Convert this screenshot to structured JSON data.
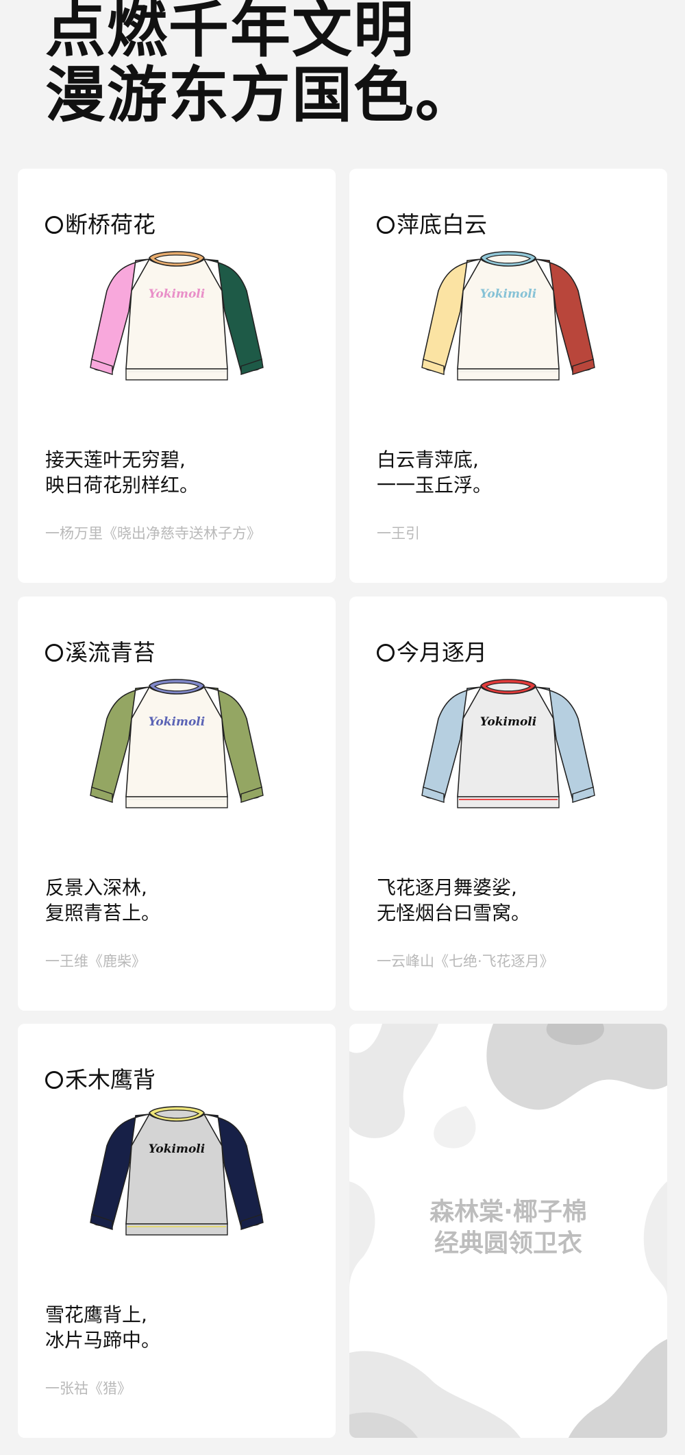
{
  "headline": {
    "line1": "点燃千年文明",
    "line2": "漫游东方国色。"
  },
  "products": [
    {
      "title": "断桥荷花",
      "brand": "Yokimoli",
      "colors": {
        "left": "#f8a8dc",
        "right": "#1e5a47",
        "collar": "#e9ad6e",
        "body": "#fbf7ef",
        "logo": "#e98fc8",
        "hem": "#f2efe8"
      },
      "poem1": "接天莲叶无穷碧,",
      "poem2": "映日荷花别样红。",
      "source": "一杨万里《晓出净慈寺送林子方》"
    },
    {
      "title": "萍底白云",
      "brand": "Yokimoli",
      "colors": {
        "left": "#fbe3a3",
        "right": "#b9463b",
        "collar": "#92c8d8",
        "body": "#fbf7ef",
        "logo": "#86c2d6",
        "hem": "#f2efe8"
      },
      "poem1": "白云青萍底,",
      "poem2": "一一玉丘浮。",
      "source": "一王引"
    },
    {
      "title": "溪流青苔",
      "brand": "Yokimoli",
      "colors": {
        "left": "#94a663",
        "right": "#94a663",
        "collar": "#8088c9",
        "body": "#fbf7ef",
        "logo": "#5a63b5",
        "hem": "#f2efe8"
      },
      "poem1": "反景入深林,",
      "poem2": "复照青苔上。",
      "source": "一王维《鹿柴》"
    },
    {
      "title": "今月逐月",
      "brand": "Yokimoli",
      "colors": {
        "left": "#b6cfe0",
        "right": "#b6cfe0",
        "collar": "#e23b3b",
        "body": "#ececec",
        "logo": "#111111",
        "hem": "#e94848"
      },
      "poem1": "飞花逐月舞婆娑,",
      "poem2": "无怪烟台曰雪窝。",
      "source": "一云峰山《七绝·飞花逐月》"
    },
    {
      "title": "禾木鹰背",
      "brand": "Yokimoli",
      "colors": {
        "left": "#172047",
        "right": "#172047",
        "collar": "#eee57a",
        "body": "#d4d4d4",
        "logo": "#111111",
        "hem": "#e2d874"
      },
      "poem1": "雪花鹰背上,",
      "poem2": "冰片马蹄中。",
      "source": "一张祜《猎》"
    }
  ],
  "promo": {
    "line1": "森林棠·椰子棉",
    "line2": "经典圆领卫衣"
  }
}
